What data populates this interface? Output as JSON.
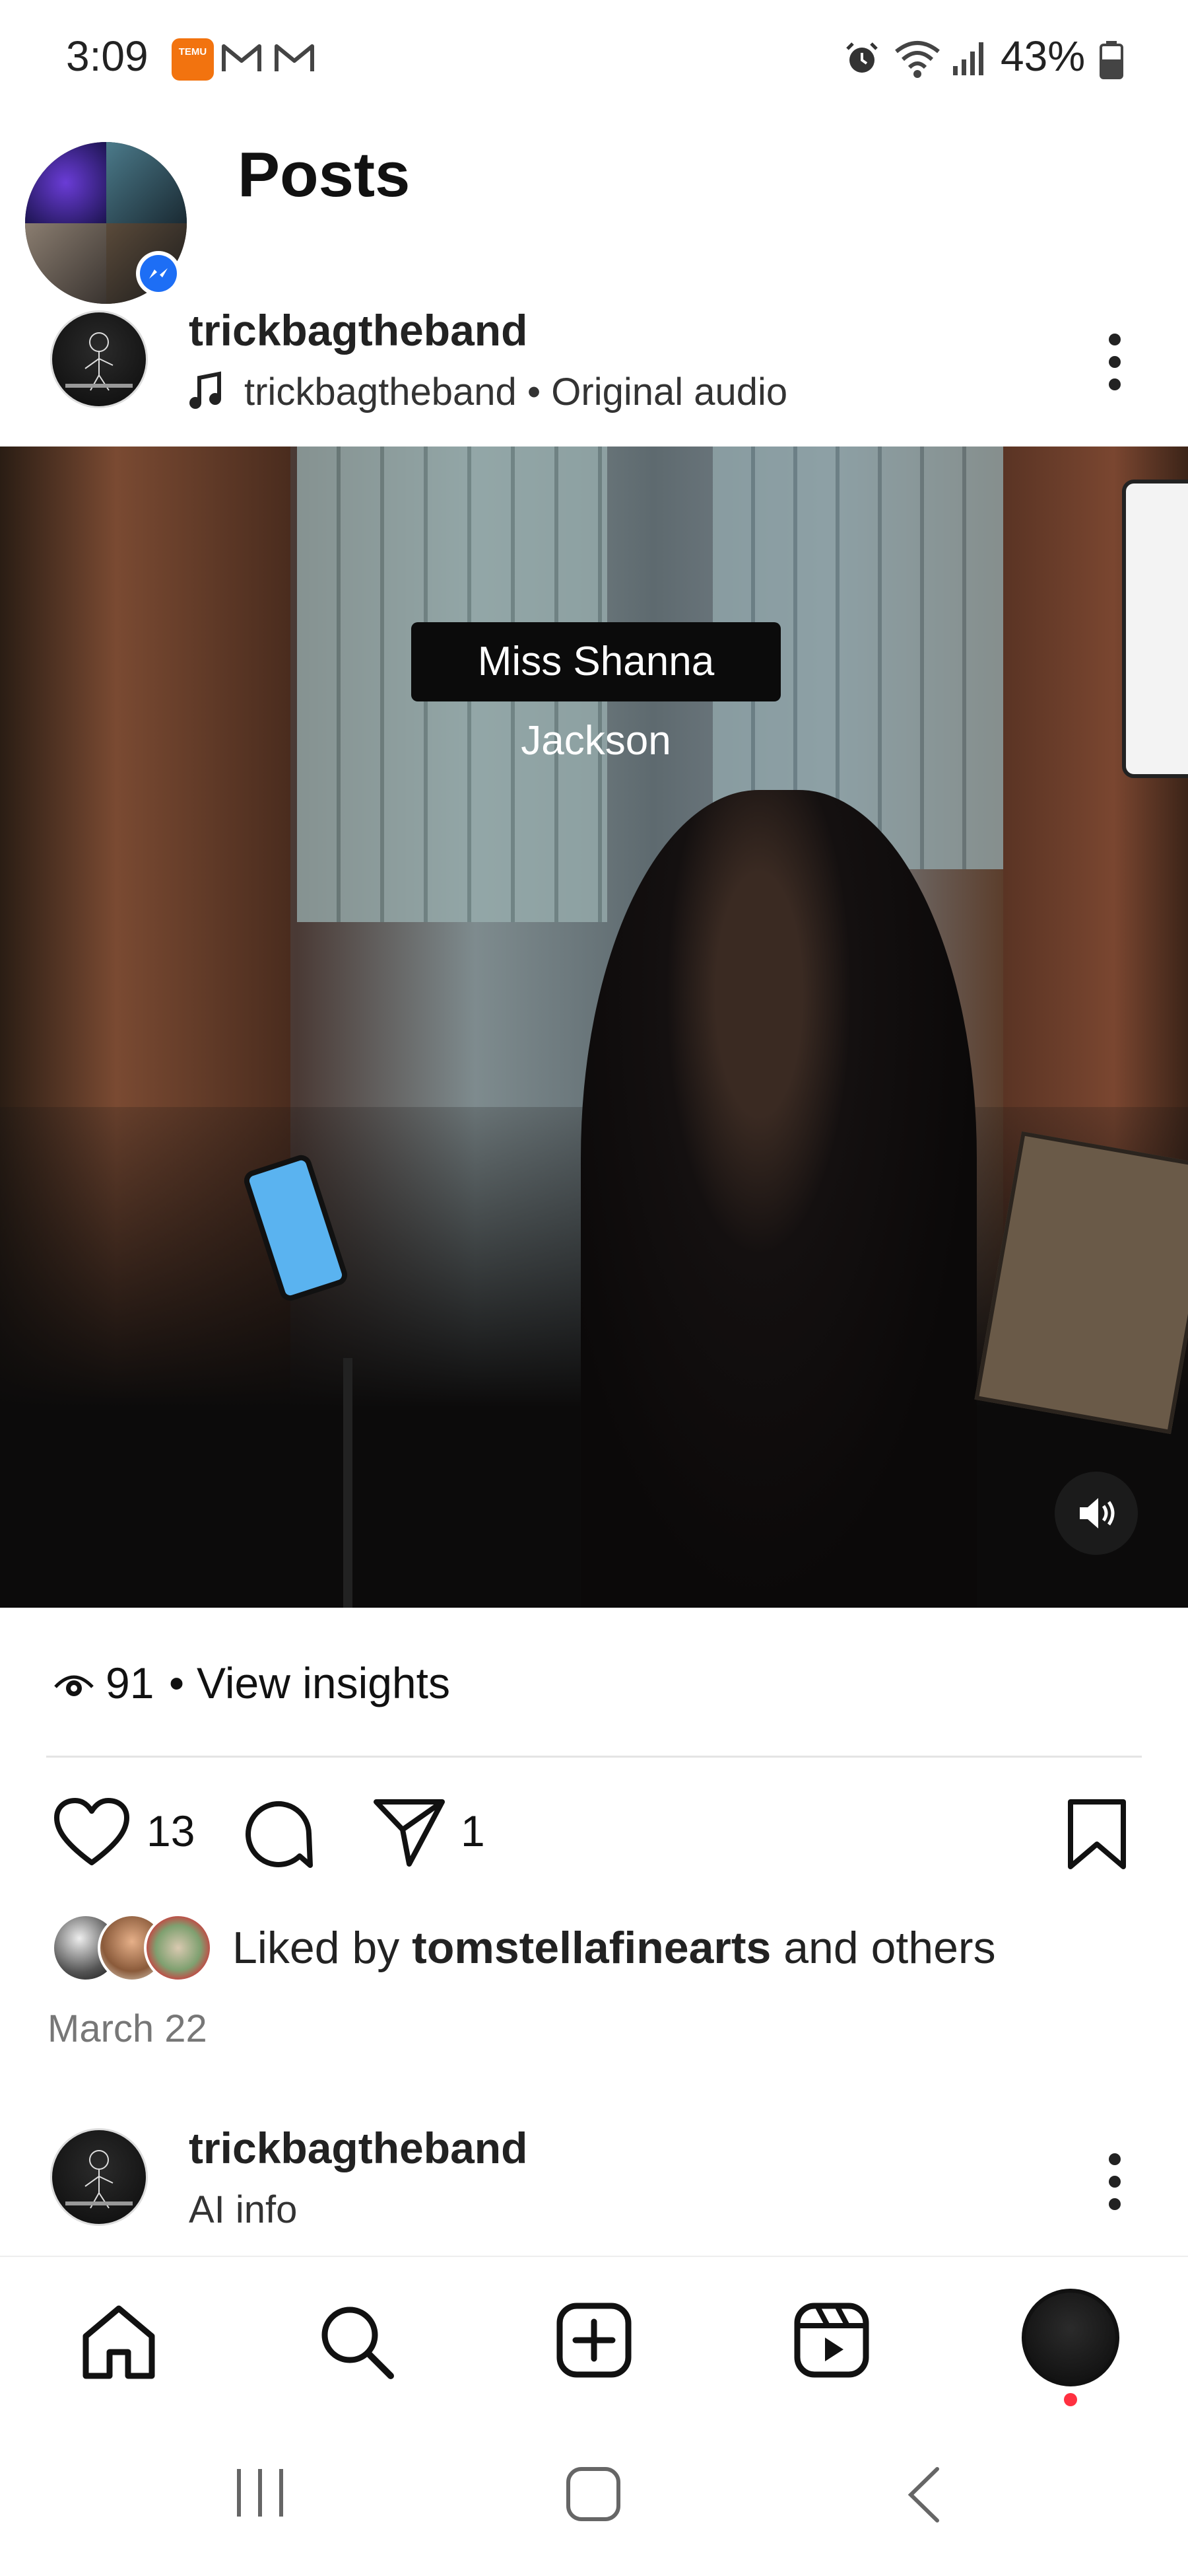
{
  "status_bar": {
    "time": "3:09",
    "temu_label": "TEMU",
    "battery": "43%"
  },
  "header": {
    "title": "Posts"
  },
  "post": {
    "username": "trickbagtheband",
    "audio": "trickbagtheband • Original audio",
    "caption_overlay": "Miss Shanna Jackson",
    "views": "91",
    "insights_label": "View insights",
    "likes_count": "13",
    "shares_count": "1",
    "liked_by_prefix": "Liked by ",
    "liked_by_user": "tomstellafinearts",
    "liked_by_suffix": " and others",
    "date": "March 22"
  },
  "next_post": {
    "username": "trickbagtheband",
    "subtitle": "AI info"
  },
  "colors": {
    "accent_blue": "#1d6ef5",
    "temu_orange": "#f2730f",
    "notification_dot": "#ff3040"
  },
  "icons": {
    "status": [
      "temu-icon",
      "gmail-icon",
      "gmail-icon",
      "alarm-icon",
      "wifi-icon",
      "signal-icon",
      "battery-icon"
    ],
    "bottom_nav": [
      "home-icon",
      "search-icon",
      "create-icon",
      "reels-icon",
      "profile-avatar"
    ],
    "system_nav": [
      "recents-icon",
      "home-button-icon",
      "back-icon"
    ]
  }
}
